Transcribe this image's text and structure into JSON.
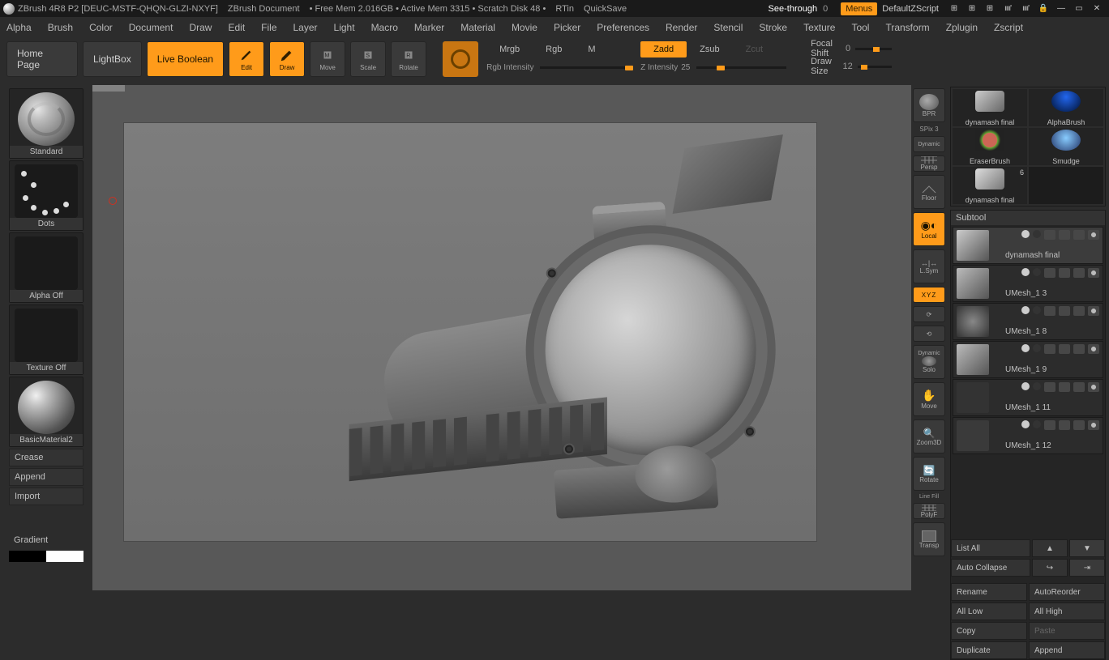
{
  "title": "ZBrush 4R8 P2 [DEUC-MSTF-QHQN-GLZI-NXYF]",
  "docTitle": "ZBrush Document",
  "status": "• Free Mem 2.016GB • Active Mem 3315 • Scratch Disk 48 •",
  "rtin": "RTin",
  "quicksave": "QuickSave",
  "seeThrough": {
    "label": "See-through",
    "value": "0"
  },
  "menusBtn": "Menus",
  "scriptLabel": "DefaultZScript",
  "menus": [
    "Alpha",
    "Brush",
    "Color",
    "Document",
    "Draw",
    "Edit",
    "File",
    "Layer",
    "Light",
    "Macro",
    "Marker",
    "Material",
    "Movie",
    "Picker",
    "Preferences",
    "Render",
    "Stencil",
    "Stroke",
    "Texture",
    "Tool",
    "Transform",
    "Zplugin",
    "Zscript"
  ],
  "toolbar": {
    "home": "Home Page",
    "lightbox": "LightBox",
    "liveBoolean": "Live Boolean",
    "edit": "Edit",
    "draw": "Draw",
    "move": "Move",
    "scale": "Scale",
    "rotate": "Rotate"
  },
  "blend": {
    "mrgb": "Mrgb",
    "rgb": "Rgb",
    "m": "M",
    "zadd": "Zadd",
    "zsub": "Zsub",
    "zcut": "Zcut",
    "rgbIntensity": "Rgb Intensity",
    "zIntensity": {
      "label": "Z Intensity",
      "value": "25"
    },
    "focalShift": {
      "label": "Focal Shift",
      "value": "0"
    },
    "drawSize": {
      "label": "Draw Size",
      "value": "12"
    }
  },
  "leftTray": {
    "brush": "Standard",
    "stroke": "Dots",
    "alpha": "Alpha Off",
    "texture": "Texture Off",
    "material": "BasicMaterial2",
    "crease": "Crease",
    "append": "Append",
    "import": "Import",
    "gradient": "Gradient"
  },
  "rightShelf": {
    "bpr": "BPR",
    "spix": {
      "label": "SPix",
      "value": "3"
    },
    "dynamic": "Dynamic",
    "persp": "Persp",
    "floor": "Floor",
    "local": "Local",
    "lsym": "L.Sym",
    "xyz": "XYZ",
    "dynamicSolo": "Dynamic",
    "solo": "Solo",
    "move": "Move",
    "zoom": "Zoom3D",
    "rotate": "Rotate",
    "lineFill": "Line Fill",
    "polyf": "PolyF",
    "transp": "Transp"
  },
  "brushGrid": [
    {
      "name": "dynamash final"
    },
    {
      "name": "AlphaBrush"
    },
    {
      "name": "EraserBrush"
    },
    {
      "name": "Smudge"
    },
    {
      "name": "dynamash final",
      "count": "6"
    }
  ],
  "subtool": {
    "header": "Subtool",
    "items": [
      {
        "name": "dynamash final",
        "selected": true
      },
      {
        "name": "UMesh_1 3"
      },
      {
        "name": "UMesh_1 8"
      },
      {
        "name": "UMesh_1 9"
      },
      {
        "name": "UMesh_1 11"
      },
      {
        "name": "UMesh_1 12"
      }
    ],
    "listAll": "List All",
    "autoCollapse": "Auto Collapse",
    "rename": "Rename",
    "autoReorder": "AutoReorder",
    "allLow": "All Low",
    "allHigh": "All High",
    "copy": "Copy",
    "paste": "Paste",
    "duplicate": "Duplicate",
    "append2": "Append"
  }
}
